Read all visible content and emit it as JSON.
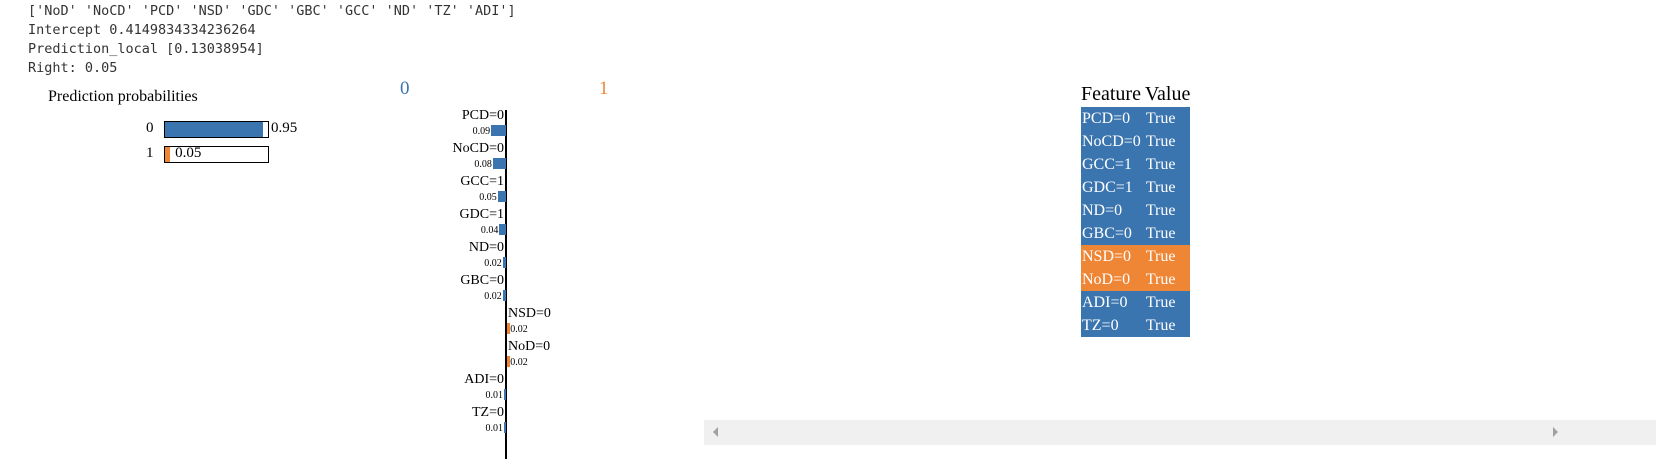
{
  "output_lines": {
    "features": "['NoD' 'NoCD' 'PCD' 'NSD' 'GDC' 'GBC' 'GCC' 'ND' 'TZ' 'ADI']",
    "intercept": "Intercept 0.4149834334236264",
    "prediction_local": "Prediction_local [0.13038954]",
    "right": "Right: 0.05"
  },
  "colors": {
    "class0": "#3b75af",
    "class1": "#ef8636"
  },
  "prediction_probabilities": {
    "title": "Prediction probabilities",
    "rows": [
      {
        "label": "0",
        "value": 0.95,
        "value_text": "0.95"
      },
      {
        "label": "1",
        "value": 0.05,
        "value_text": "0.05"
      }
    ]
  },
  "chart_data": {
    "type": "bar",
    "class_labels": [
      "0",
      "1"
    ],
    "features": [
      {
        "name": "PCD=0",
        "weight": 0.09,
        "text": "0.09",
        "class": 0
      },
      {
        "name": "NoCD=0",
        "weight": 0.08,
        "text": "0.08",
        "class": 0
      },
      {
        "name": "GCC=1",
        "weight": 0.05,
        "text": "0.05",
        "class": 0
      },
      {
        "name": "GDC=1",
        "weight": 0.04,
        "text": "0.04",
        "class": 0
      },
      {
        "name": "ND=0",
        "weight": 0.02,
        "text": "0.02",
        "class": 0
      },
      {
        "name": "GBC=0",
        "weight": 0.02,
        "text": "0.02",
        "class": 0
      },
      {
        "name": "NSD=0",
        "weight": 0.02,
        "text": "0.02",
        "class": 1
      },
      {
        "name": "NoD=0",
        "weight": 0.02,
        "text": "0.02",
        "class": 1
      },
      {
        "name": "ADI=0",
        "weight": 0.01,
        "text": "0.01",
        "class": 0
      },
      {
        "name": "TZ=0",
        "weight": 0.01,
        "text": "0.01",
        "class": 0
      }
    ]
  },
  "feature_table": {
    "headers": [
      "Feature",
      "Value"
    ],
    "rows": [
      {
        "feature": "PCD=0",
        "value": "True",
        "class": 0
      },
      {
        "feature": "NoCD=0",
        "value": "True",
        "class": 0
      },
      {
        "feature": "GCC=1",
        "value": "True",
        "class": 0
      },
      {
        "feature": "GDC=1",
        "value": "True",
        "class": 0
      },
      {
        "feature": "ND=0",
        "value": "True",
        "class": 0
      },
      {
        "feature": "GBC=0",
        "value": "True",
        "class": 0
      },
      {
        "feature": "NSD=0",
        "value": "True",
        "class": 1
      },
      {
        "feature": "NoD=0",
        "value": "True",
        "class": 1
      },
      {
        "feature": "ADI=0",
        "value": "True",
        "class": 0
      },
      {
        "feature": "TZ=0",
        "value": "True",
        "class": 0
      }
    ]
  }
}
